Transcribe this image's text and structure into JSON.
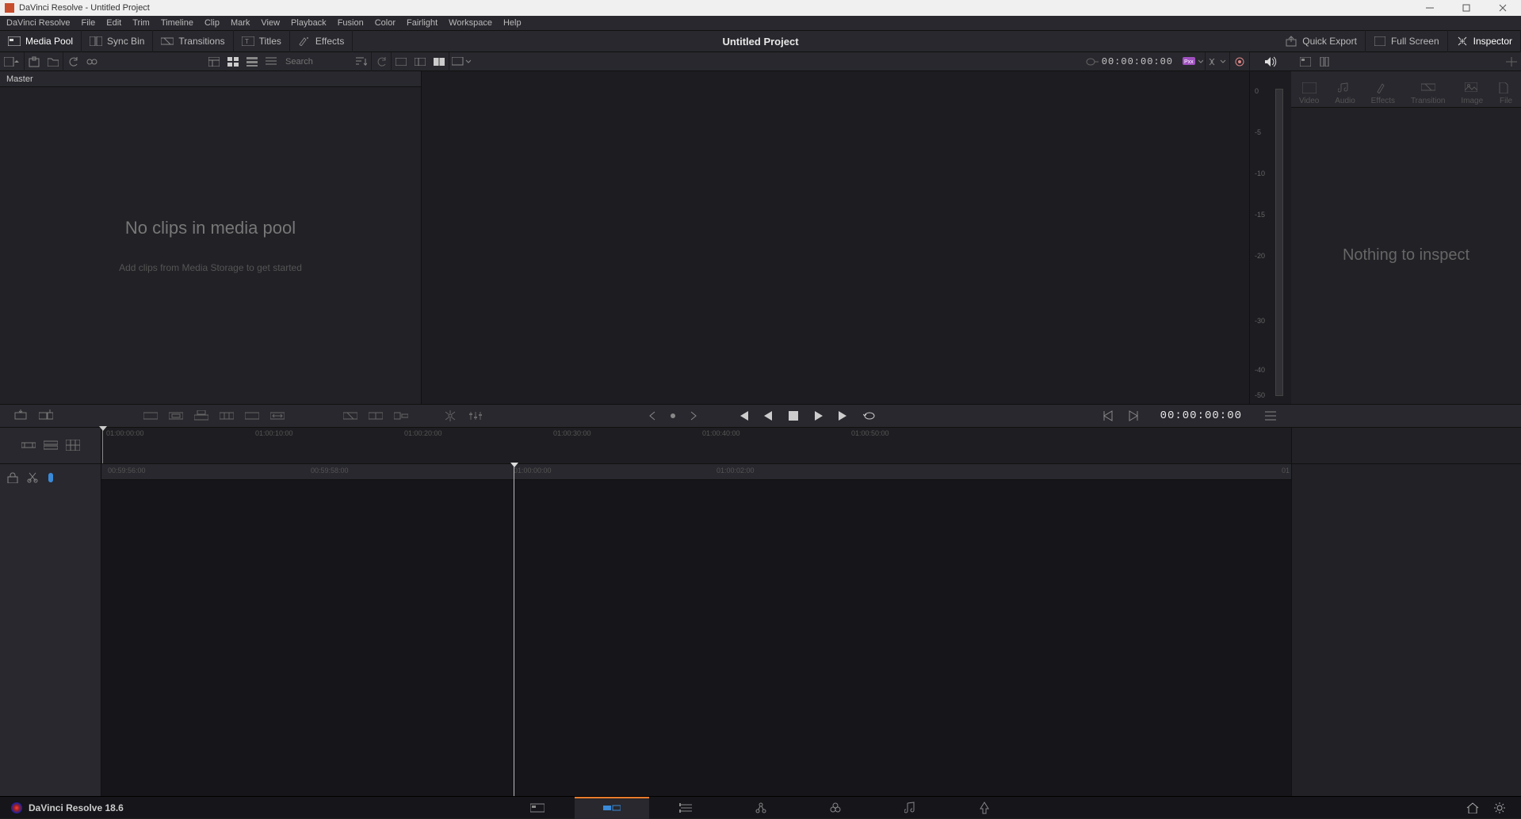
{
  "window": {
    "title": "DaVinci Resolve - Untitled Project"
  },
  "menubar": [
    "DaVinci Resolve",
    "File",
    "Edit",
    "Trim",
    "Timeline",
    "Clip",
    "Mark",
    "View",
    "Playback",
    "Fusion",
    "Color",
    "Fairlight",
    "Workspace",
    "Help"
  ],
  "apptoolbar": {
    "mediaPool": "Media Pool",
    "syncBin": "Sync Bin",
    "transitions": "Transitions",
    "titles": "Titles",
    "effects": "Effects",
    "projectTitle": "Untitled Project",
    "quickExport": "Quick Export",
    "fullScreen": "Full Screen",
    "inspector": "Inspector"
  },
  "mpToolbar": {
    "searchPlaceholder": "Search",
    "viewerTimecode": "00:00:00:00"
  },
  "mediaPool": {
    "breadcrumb": "Master",
    "emptyL1": "No clips in media pool",
    "emptyL2": "Add clips from Media Storage to get started"
  },
  "inspectorPanel": {
    "tabs": [
      "Video",
      "Audio",
      "Effects",
      "Transition",
      "Image",
      "File"
    ],
    "empty": "Nothing to inspect"
  },
  "meter": {
    "ticks": [
      "0",
      "-5",
      "-10",
      "-15",
      "-20",
      "-30",
      "-40",
      "-50"
    ]
  },
  "midbar": {
    "recordTimecode": "00:00:00:00"
  },
  "tl1": {
    "ticks": [
      "01:00:00:00",
      "01:00:10:00",
      "01:00:20:00",
      "01:00:30:00",
      "01:00:40:00",
      "01:00:50:00"
    ]
  },
  "tl2": {
    "ticks": [
      "00:59:56:00",
      "00:59:58:00",
      "01:00:00:00",
      "01:00:02:00"
    ],
    "rightEdge": "01"
  },
  "pagebar": {
    "brand": "DaVinci Resolve 18.6"
  }
}
